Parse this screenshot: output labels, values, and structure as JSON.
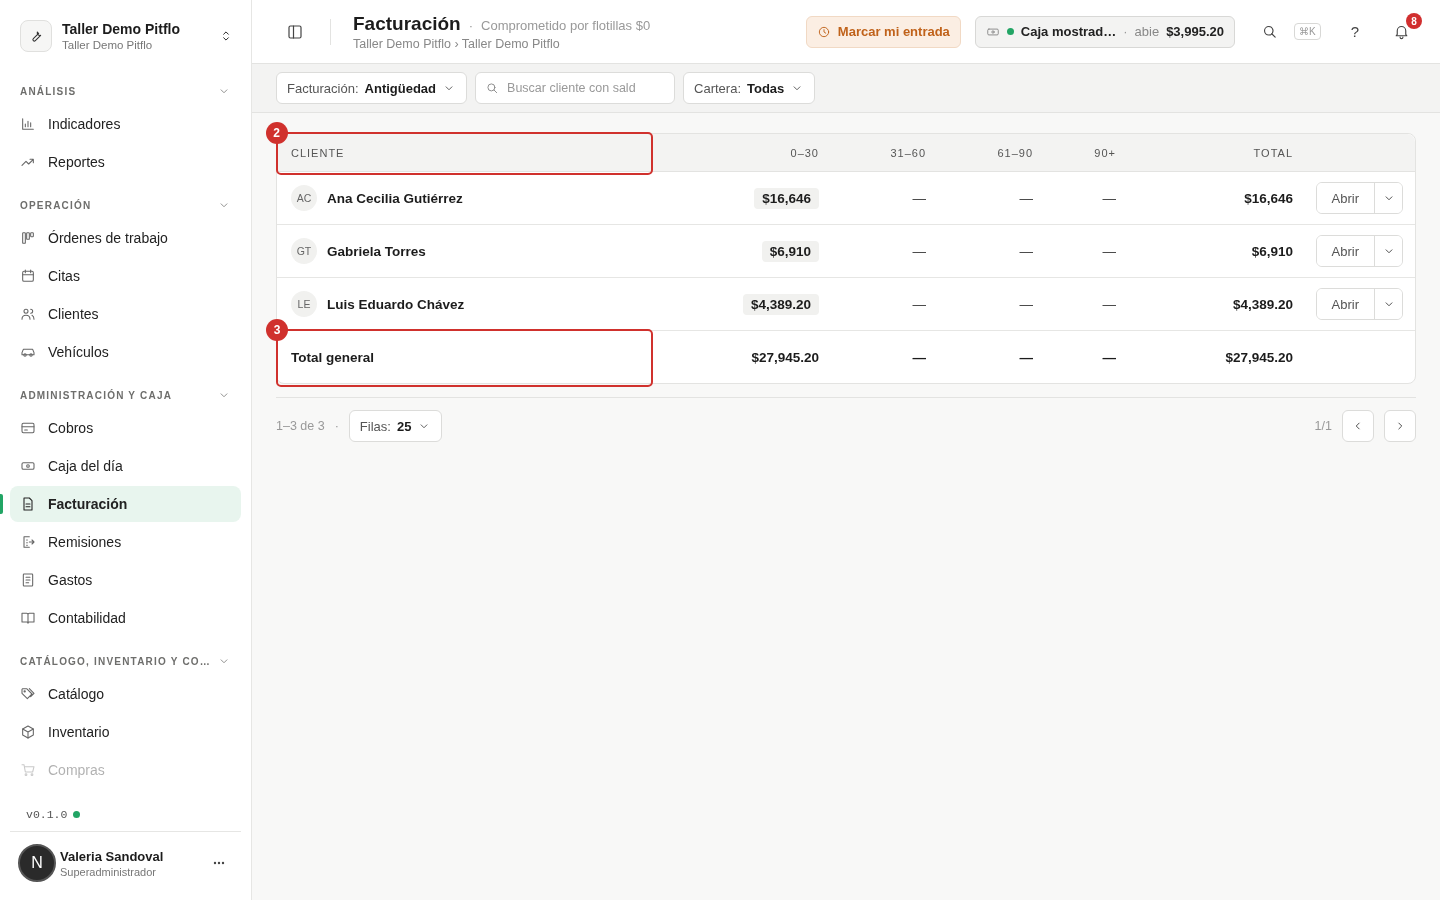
{
  "sidebar": {
    "workspace": {
      "name": "Taller Demo Pitflo",
      "subtitle": "Taller Demo Pitflo"
    },
    "sections": [
      {
        "label": "ANÁLISIS",
        "expanded": true,
        "items": [
          {
            "label": "Indicadores",
            "selected": false
          },
          {
            "label": "Reportes",
            "selected": false
          }
        ]
      },
      {
        "label": "OPERACIÓN",
        "expanded": true,
        "items": [
          {
            "label": "Órdenes de trabajo",
            "selected": false
          },
          {
            "label": "Citas",
            "selected": false
          },
          {
            "label": "Clientes",
            "selected": false
          },
          {
            "label": "Vehículos",
            "selected": false
          }
        ]
      },
      {
        "label": "ADMINISTRACIÓN Y CAJA",
        "expanded": true,
        "items": [
          {
            "label": "Cobros",
            "selected": false
          },
          {
            "label": "Caja del día",
            "selected": false
          },
          {
            "label": "Facturación",
            "selected": true
          },
          {
            "label": "Remisiones",
            "selected": false
          },
          {
            "label": "Gastos",
            "selected": false
          },
          {
            "label": "Contabilidad",
            "selected": false
          }
        ]
      },
      {
        "label": "CATÁLOGO, INVENTARIO Y CO…",
        "expanded": true,
        "items": [
          {
            "label": "Catálogo",
            "selected": false
          },
          {
            "label": "Inventario",
            "selected": false
          },
          {
            "label": "Compras",
            "selected": false
          }
        ]
      }
    ],
    "version": "v0.1.0",
    "user": {
      "initial": "N",
      "name": "Valeria Sandoval",
      "role": "Superadministrador"
    }
  },
  "header": {
    "title": "Facturación",
    "separator": "·",
    "subtitle": "Comprometido por flotillas $0",
    "breadcrumb": "Taller Demo Pitflo › Taller Demo Pitflo",
    "clock_in_button": "Marcar mi entrada",
    "cash_register": {
      "name": "Caja mostrad…",
      "separator": "·",
      "status": "abie",
      "amount": "$3,995.20"
    },
    "shortcut": "⌘K",
    "help": "?",
    "notifications": "8"
  },
  "filters": {
    "billing": {
      "label": "Facturación:",
      "value": "Antigüedad"
    },
    "search": {
      "placeholder": "Buscar cliente con sald"
    },
    "portfolio": {
      "label": "Cartera:",
      "value": "Todas"
    }
  },
  "table": {
    "columns": [
      "CLIENTE",
      "0–30",
      "31–60",
      "61–90",
      "90+",
      "TOTAL"
    ],
    "header_callout": "2",
    "rows": [
      {
        "initials": "AC",
        "client": "Ana Cecilia Gutiérrez",
        "d0_30": "$16,646",
        "d31_60": "—",
        "d61_90": "—",
        "d90": "—",
        "total": "$16,646",
        "action": "Abrir"
      },
      {
        "initials": "GT",
        "client": "Gabriela Torres",
        "d0_30": "$6,910",
        "d31_60": "—",
        "d61_90": "—",
        "d90": "—",
        "total": "$6,910",
        "action": "Abrir"
      },
      {
        "initials": "LE",
        "client": "Luis Eduardo Chávez",
        "d0_30": "$4,389.20",
        "d31_60": "—",
        "d61_90": "—",
        "d90": "—",
        "total": "$4,389.20",
        "action": "Abrir"
      }
    ],
    "total": {
      "label": "Total general",
      "d0_30": "$27,945.20",
      "d31_60": "—",
      "d61_90": "—",
      "d90": "—",
      "total": "$27,945.20",
      "callout": "3"
    }
  },
  "pagination": {
    "range": "1–3 de 3",
    "separator": "·",
    "rows_label": "Filas:",
    "rows_value": "25",
    "page": "1/1"
  }
}
